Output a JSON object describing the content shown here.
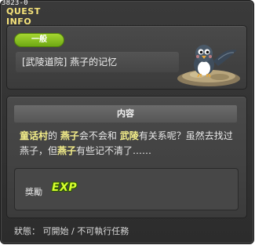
{
  "build_id": "3823-0",
  "window": {
    "title": "QUEST INFO"
  },
  "quest": {
    "category": "一般",
    "name": "[武陵道院] 燕子的记忆",
    "npc_icon": "swallow-bird-icon"
  },
  "content": {
    "header": "内容",
    "segments": [
      {
        "text": "童话村",
        "highlight": true
      },
      {
        "text": "的 ",
        "highlight": false
      },
      {
        "text": "燕子",
        "highlight": true
      },
      {
        "text": "会不会和 ",
        "highlight": false
      },
      {
        "text": "武陵",
        "highlight": true
      },
      {
        "text": "有关系呢？虽然去找过燕子，但",
        "highlight": false
      },
      {
        "text": "燕子",
        "highlight": true
      },
      {
        "text": "有些记不清了……",
        "highlight": false
      }
    ]
  },
  "reward": {
    "label": "獎勵",
    "exp_label": "EXP"
  },
  "status": {
    "text": "狀態： 可開始 / 不可執行任務"
  },
  "colors": {
    "highlight": "#f4ee8a",
    "badge": "#8cc520",
    "exp": "#d7ff2e"
  }
}
